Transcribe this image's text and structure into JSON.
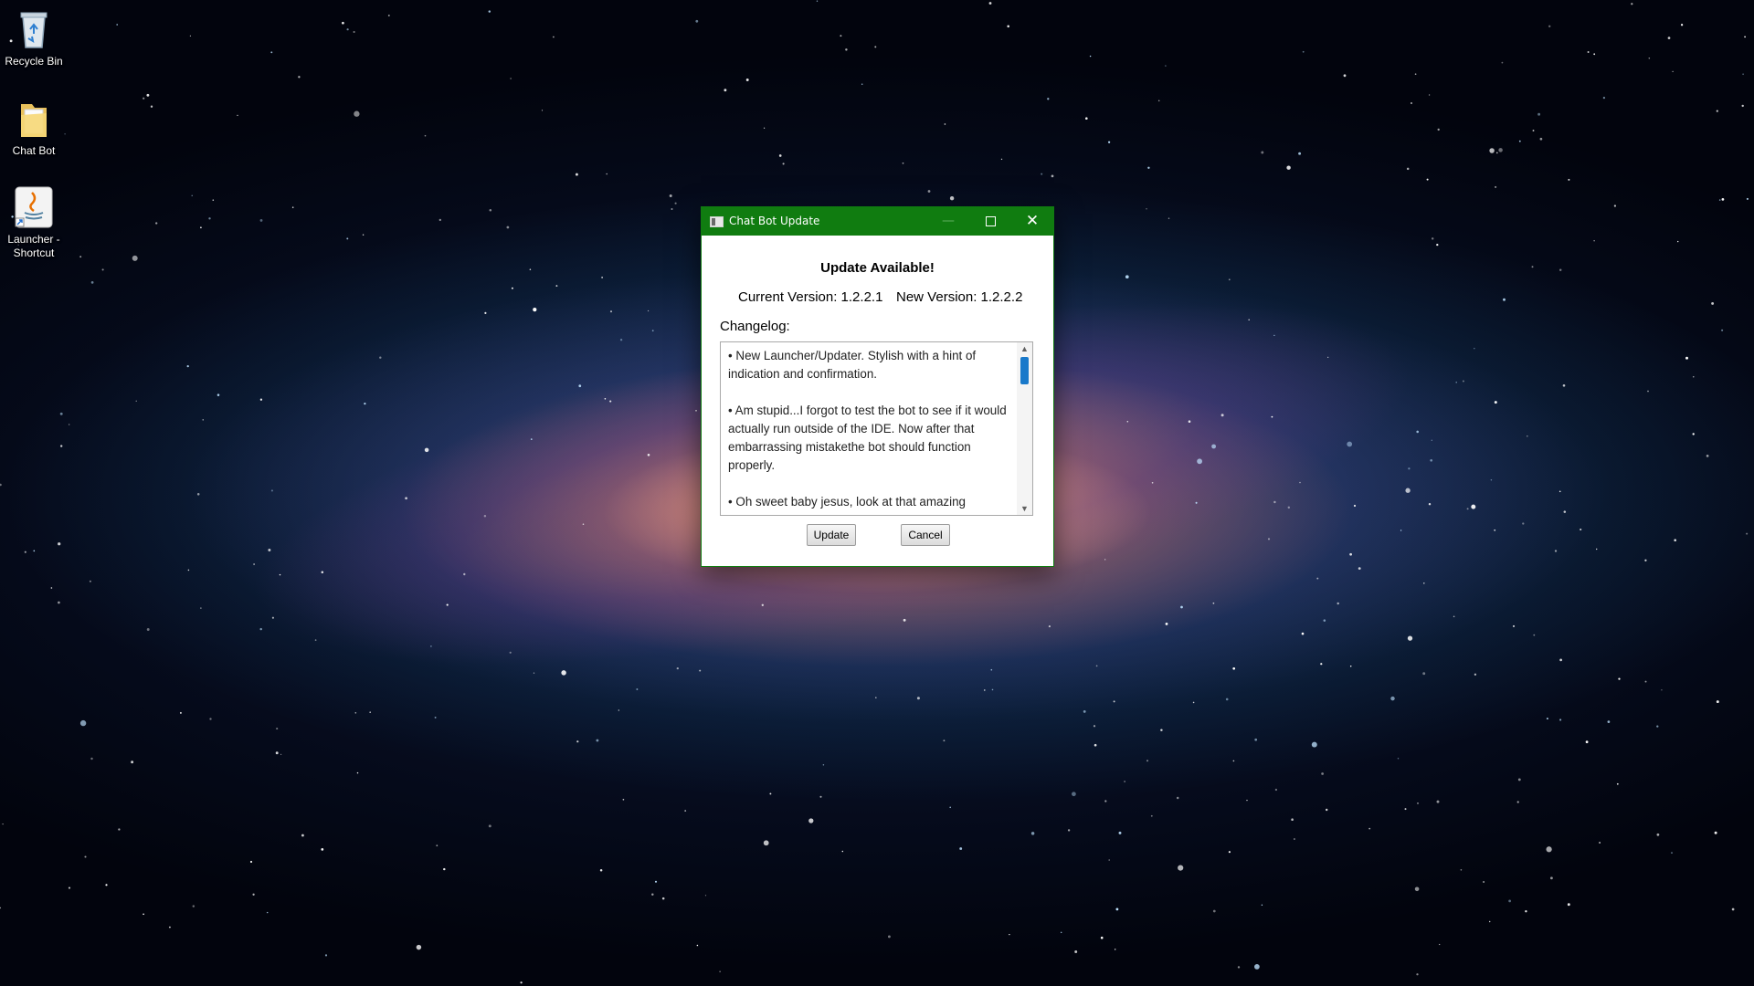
{
  "desktop": {
    "icons": [
      {
        "label": "Recycle Bin",
        "icon": "recycle-bin-icon"
      },
      {
        "label": "Chat Bot",
        "icon": "folder-icon"
      },
      {
        "label": "Launcher - Shortcut",
        "icon": "java-icon"
      }
    ]
  },
  "dialog": {
    "title": "Chat Bot Update",
    "heading": "Update Available!",
    "current_version": "Current Version: 1.2.2.1",
    "new_version": "New Version: 1.2.2.2",
    "changelog_label": "Changelog:",
    "changelog": [
      "• New Launcher/Updater. Stylish with a hint of indication and confirmation.",
      "• Am stupid...I forgot to test the bot to see if it would actually run outside of the IDE. Now after that embarrassing mistakethe bot should function properly.",
      "• Oh sweet baby jesus, look at that amazing"
    ],
    "update_label": "Update",
    "cancel_label": "Cancel",
    "accent_color": "#107c10",
    "scroll_thumb_color": "#1979ca"
  }
}
